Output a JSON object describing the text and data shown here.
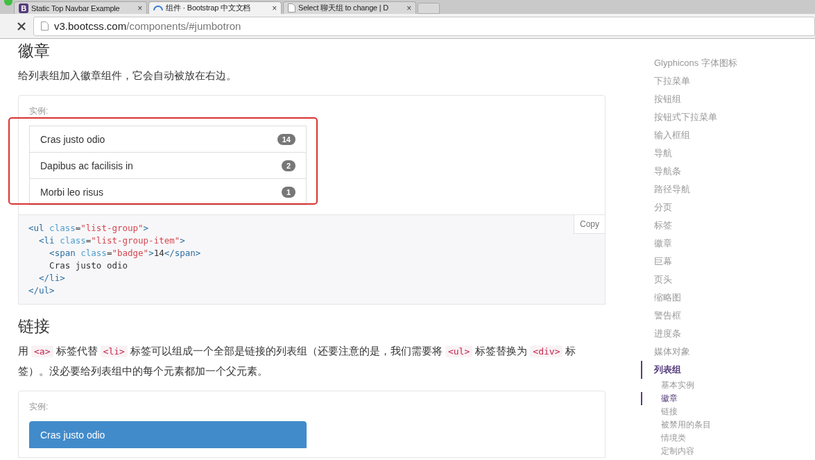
{
  "browser": {
    "tabs": [
      {
        "kind": "logo",
        "logo_letter": "B",
        "title": "Static Top Navbar Example",
        "close": "×",
        "selected": false
      },
      {
        "kind": "loading",
        "title": "组件 · Bootstrap 中文文档",
        "close": "×",
        "selected": true
      },
      {
        "kind": "page",
        "title": "Select 聊天组 to change | D",
        "close": "×",
        "selected": false
      }
    ],
    "address": {
      "host": "v3.bootcss.com",
      "path": "/components/#jumbotron"
    }
  },
  "badges_section": {
    "heading": "徽章",
    "description": "给列表组加入徽章组件，它会自动被放在右边。",
    "example_label": "实例:",
    "items": [
      {
        "text": "Cras justo odio",
        "badge": "14"
      },
      {
        "text": "Dapibus ac facilisis in",
        "badge": "2"
      },
      {
        "text": "Morbi leo risus",
        "badge": "1"
      }
    ],
    "copy_button": "Copy",
    "code": [
      [
        {
          "kind": "tag",
          "text": "<ul "
        },
        {
          "kind": "attr",
          "text": "class"
        },
        {
          "kind": "text",
          "text": "="
        },
        {
          "kind": "string",
          "text": "\"list-group\""
        },
        {
          "kind": "tag",
          "text": ">"
        }
      ],
      [
        {
          "kind": "tag",
          "text": "  <li "
        },
        {
          "kind": "attr",
          "text": "class"
        },
        {
          "kind": "text",
          "text": "="
        },
        {
          "kind": "string",
          "text": "\"list-group-item\""
        },
        {
          "kind": "tag",
          "text": ">"
        }
      ],
      [
        {
          "kind": "tag",
          "text": "    <span "
        },
        {
          "kind": "attr",
          "text": "class"
        },
        {
          "kind": "text",
          "text": "="
        },
        {
          "kind": "string",
          "text": "\"badge\""
        },
        {
          "kind": "tag",
          "text": ">"
        },
        {
          "kind": "text",
          "text": "14"
        },
        {
          "kind": "tag",
          "text": "</span>"
        }
      ],
      [
        {
          "kind": "text",
          "text": "    Cras justo odio"
        }
      ],
      [
        {
          "kind": "tag",
          "text": "  </li>"
        }
      ],
      [
        {
          "kind": "tag",
          "text": "</ul>"
        }
      ]
    ]
  },
  "links_section": {
    "heading": "链接",
    "description": [
      {
        "kind": "text",
        "text": "用 "
      },
      {
        "kind": "code",
        "text": "<a>"
      },
      {
        "kind": "text",
        "text": " 标签代替 "
      },
      {
        "kind": "code",
        "text": "<li>"
      },
      {
        "kind": "text",
        "text": " 标签可以组成一个全部是链接的列表组（还要注意的是，我们需要将 "
      },
      {
        "kind": "code",
        "text": "<ul>"
      },
      {
        "kind": "text",
        "text": " 标签替换为 "
      },
      {
        "kind": "code",
        "text": "<div>"
      },
      {
        "kind": "text",
        "text": " 标签）。没必要给列表组中的每个元素都加一个父元素。"
      }
    ],
    "example_label": "实例:",
    "items": [
      {
        "text": "Cras justo odio",
        "selected": true
      }
    ]
  },
  "sidebar": {
    "items": [
      {
        "label": "Glyphicons 字体图标",
        "selected": false
      },
      {
        "label": "下拉菜单",
        "selected": false
      },
      {
        "label": "按钮组",
        "selected": false
      },
      {
        "label": "按钮式下拉菜单",
        "selected": false
      },
      {
        "label": "输入框组",
        "selected": false
      },
      {
        "label": "导航",
        "selected": false
      },
      {
        "label": "导航条",
        "selected": false
      },
      {
        "label": "路径导航",
        "selected": false
      },
      {
        "label": "分页",
        "selected": false
      },
      {
        "label": "标签",
        "selected": false
      },
      {
        "label": "徽章",
        "selected": false
      },
      {
        "label": "巨幕",
        "selected": false
      },
      {
        "label": "页头",
        "selected": false
      },
      {
        "label": "缩略图",
        "selected": false
      },
      {
        "label": "警告框",
        "selected": false
      },
      {
        "label": "进度条",
        "selected": false
      },
      {
        "label": "媒体对象",
        "selected": false
      },
      {
        "label": "列表组",
        "selected": true,
        "children": [
          {
            "label": "基本实例",
            "selected": false
          },
          {
            "label": "徽章",
            "selected": true
          },
          {
            "label": "链接",
            "selected": false
          },
          {
            "label": "被禁用的条目",
            "selected": false
          },
          {
            "label": "情境类",
            "selected": false
          },
          {
            "label": "定制内容",
            "selected": false
          }
        ]
      }
    ]
  }
}
